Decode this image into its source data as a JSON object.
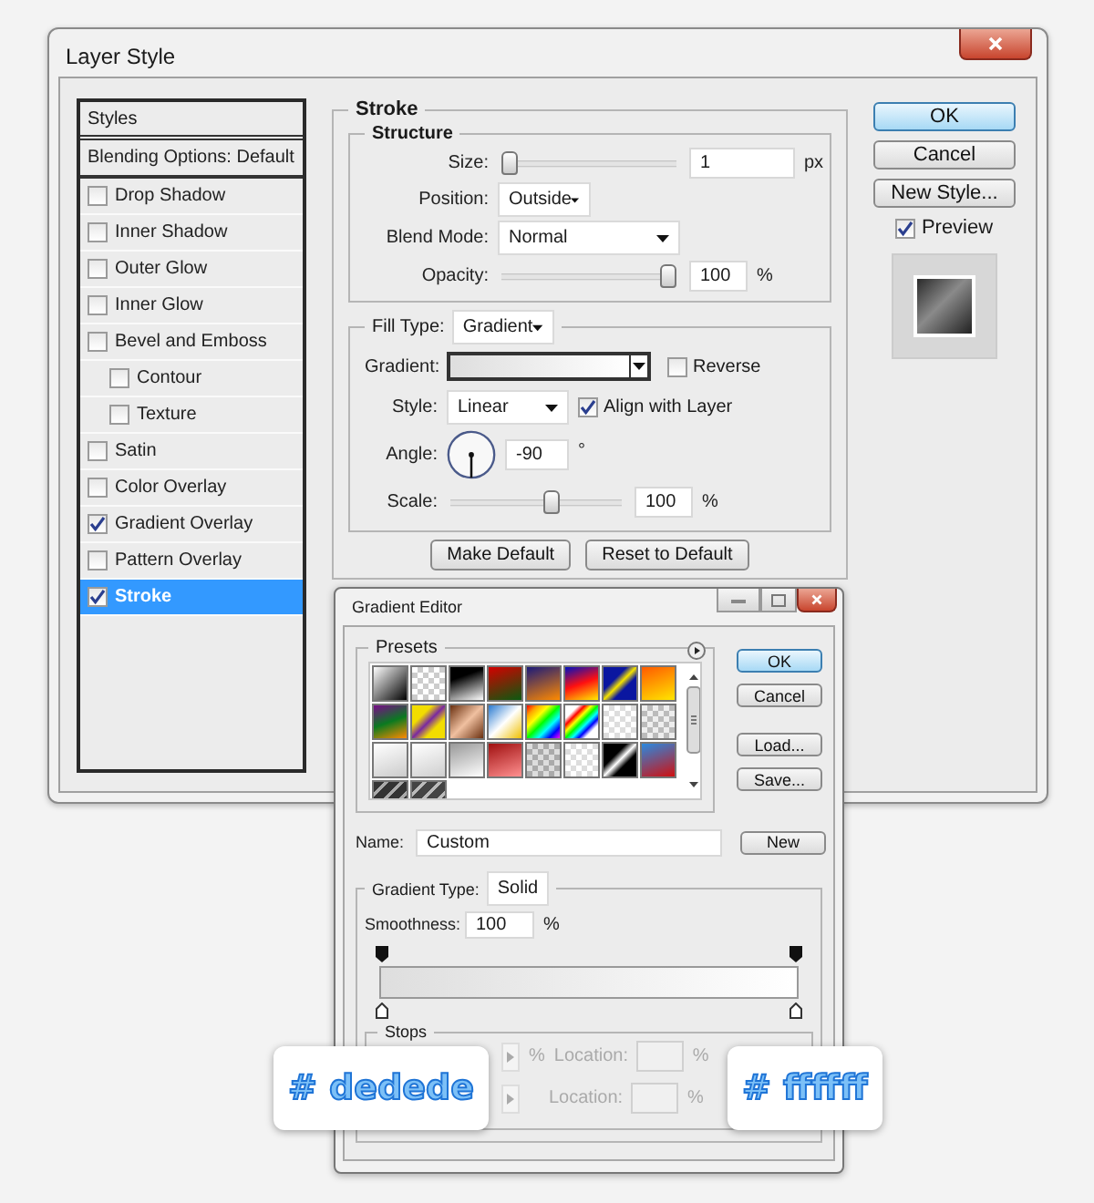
{
  "window": {
    "title": "Layer Style"
  },
  "styles": {
    "header": "Styles",
    "items": [
      {
        "label": "Blending Options: Default",
        "kind": "section",
        "selected": false
      },
      {
        "label": "Drop Shadow",
        "kind": "check",
        "checked": false,
        "selected": false
      },
      {
        "label": "Inner Shadow",
        "kind": "check",
        "checked": false,
        "selected": false
      },
      {
        "label": "Outer Glow",
        "kind": "check",
        "checked": false,
        "selected": false
      },
      {
        "label": "Inner Glow",
        "kind": "check",
        "checked": false,
        "selected": false
      },
      {
        "label": "Bevel and Emboss",
        "kind": "check",
        "checked": false,
        "selected": false,
        "children": [
          {
            "label": "Contour",
            "kind": "check",
            "checked": false,
            "selected": false
          },
          {
            "label": "Texture",
            "kind": "check",
            "checked": false,
            "selected": false
          }
        ]
      },
      {
        "label": "Satin",
        "kind": "check",
        "checked": false,
        "selected": false
      },
      {
        "label": "Color Overlay",
        "kind": "check",
        "checked": false,
        "selected": false
      },
      {
        "label": "Gradient Overlay",
        "kind": "check",
        "checked": true,
        "selected": false
      },
      {
        "label": "Pattern Overlay",
        "kind": "check",
        "checked": false,
        "selected": false
      },
      {
        "label": "Stroke",
        "kind": "check",
        "checked": true,
        "selected": true
      }
    ]
  },
  "stroke": {
    "title": "Stroke",
    "structure": {
      "title": "Structure",
      "size": {
        "label": "Size:",
        "level": 0,
        "value": "1",
        "unit": "px"
      },
      "position": {
        "label": "Position:",
        "value": "Outside"
      },
      "blend_mode": {
        "label": "Blend Mode:",
        "value": "Normal"
      },
      "opacity": {
        "label": "Opacity:",
        "level": 1,
        "value": "100",
        "unit": "%"
      }
    },
    "fill": {
      "label": "Fill Type:",
      "value": "Gradient",
      "gradient_label": "Gradient:",
      "reverse": {
        "label": "Reverse",
        "checked": false
      },
      "style": {
        "label": "Style:",
        "value": "Linear"
      },
      "align": {
        "label": "Align with Layer",
        "checked": true
      },
      "angle": {
        "label": "Angle:",
        "value": "-90",
        "unit": "°"
      },
      "scale": {
        "label": "Scale:",
        "level": 0.6,
        "value": "100",
        "unit": "%"
      }
    },
    "buttons": [
      "Make Default",
      "Reset to Default"
    ]
  },
  "actions": {
    "buttons": [
      {
        "label": "OK",
        "default": true
      },
      {
        "label": "Cancel",
        "default": false
      },
      {
        "label": "New Style...",
        "default": false
      }
    ],
    "preview": {
      "label": "Preview",
      "checked": true
    }
  },
  "gradient_editor": {
    "title": "Gradient Editor",
    "presets": {
      "label": "Presets"
    },
    "buttons": [
      {
        "label": "OK",
        "default": true
      },
      {
        "label": "Cancel",
        "default": false
      },
      {
        "label": "Load...",
        "default": false
      },
      {
        "label": "Save...",
        "default": false
      }
    ],
    "name": {
      "label": "Name:",
      "value": "Custom",
      "button": "New"
    },
    "gradient_type": {
      "label": "Gradient Type:",
      "value": "Solid"
    },
    "smoothness": {
      "label": "Smoothness:",
      "value": "100",
      "unit": "%"
    },
    "stops": {
      "label": "Stops",
      "rows": [
        {
          "unit": "%",
          "location_label": "Location:",
          "location_unit": "%",
          "disabled": true
        },
        {
          "location_label": "Location:",
          "location_unit": "%",
          "disabled": true
        }
      ]
    }
  },
  "callouts": [
    {
      "text": "# dedede"
    },
    {
      "text": "# ffffff"
    }
  ]
}
